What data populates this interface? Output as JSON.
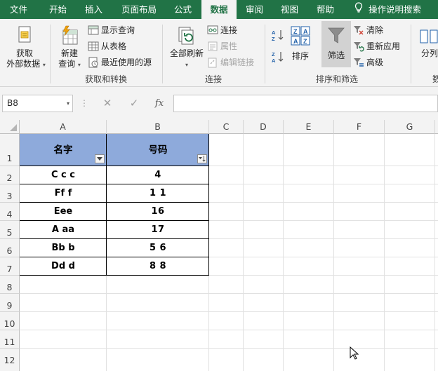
{
  "tabs": [
    "文件",
    "开始",
    "插入",
    "页面布局",
    "公式",
    "数据",
    "审阅",
    "视图",
    "帮助",
    "操作说明搜索"
  ],
  "active_tab": "数据",
  "ribbon": {
    "get_external_data": {
      "line1": "获取",
      "line2": "外部数据"
    },
    "new_query": {
      "line1": "新建",
      "line2": "查询"
    },
    "show_query": "显示查询",
    "from_table": "从表格",
    "recent_sources": "最近使用的源",
    "group_get_transform": "获取和转换",
    "refresh_all": "全部刷新",
    "connections": "连接",
    "properties": "属性",
    "edit_links": "编辑链接",
    "group_connections": "连接",
    "sort": "排序",
    "filter": "筛选",
    "clear": "清除",
    "reapply": "重新应用",
    "advanced": "高级",
    "group_sort_filter": "排序和筛选",
    "text_to_columns": "分列",
    "clipped_group": "数"
  },
  "formula_bar": {
    "name_box": "B8",
    "cancel_icon": "✕",
    "enter_icon": "✓",
    "fx_label": "fx",
    "formula": ""
  },
  "columns": [
    "A",
    "B",
    "C",
    "D",
    "E",
    "F",
    "G"
  ],
  "rows": [
    "1",
    "2",
    "3",
    "4",
    "5",
    "6",
    "7",
    "8",
    "9",
    "10",
    "11",
    "12"
  ],
  "table": {
    "headers": [
      "名字",
      "号码"
    ],
    "rows": [
      [
        "C c c",
        "4"
      ],
      [
        "Ff f",
        "1 1"
      ],
      [
        "Eee",
        "16"
      ],
      [
        "A aa",
        "17"
      ],
      [
        "Bb b",
        "5 6"
      ],
      [
        "Dd d",
        "8 8"
      ]
    ]
  },
  "colors": {
    "brand": "#217346",
    "header_fill": "#8eaadb",
    "filter_active": "#d2d2d2"
  }
}
